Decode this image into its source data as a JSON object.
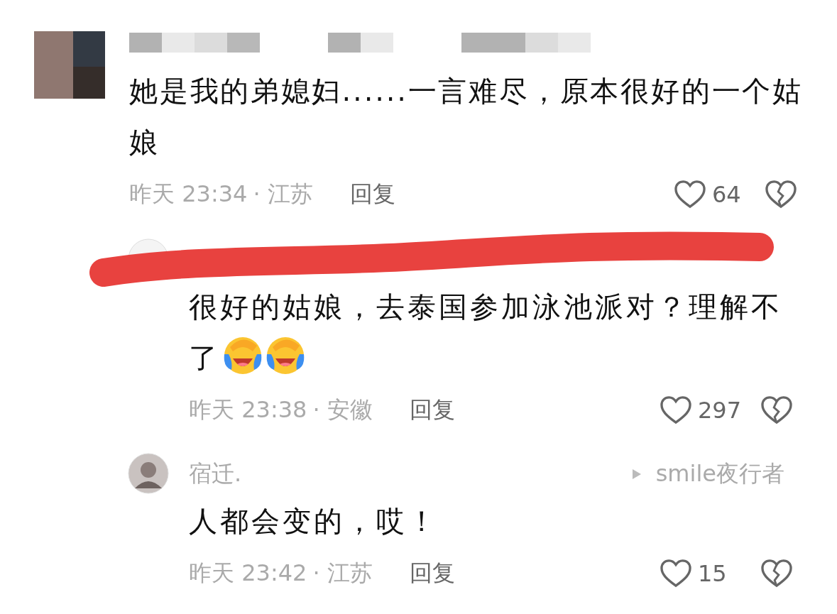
{
  "comments": [
    {
      "kind": "comment",
      "author_blurred": true,
      "text": "她是我的弟媳妇......一言难尽，原本很好的一个姑娘",
      "time": "昨天 23:34",
      "location": "· 江苏",
      "reply_label": "回复",
      "likes": "64",
      "liked": false,
      "disliked": false
    },
    {
      "kind": "reply",
      "text": "很好的姑娘，去泰国参加泳池派对？理解不了",
      "emojis": [
        {
          "kind": "laughing-crying"
        },
        {
          "kind": "laughing-crying"
        }
      ],
      "time": "昨天 23:38",
      "location": "· 安徽",
      "reply_label": "回复",
      "likes": "297",
      "liked": false,
      "disliked": false,
      "struck_out": true
    },
    {
      "kind": "reply",
      "author": "宿迁.",
      "reply_to": "smile夜行者",
      "text": "人都会变的，哎！",
      "time": "昨天 23:42",
      "location": "· 江苏",
      "reply_label": "回复",
      "likes": "15",
      "liked": false,
      "disliked": false
    }
  ]
}
